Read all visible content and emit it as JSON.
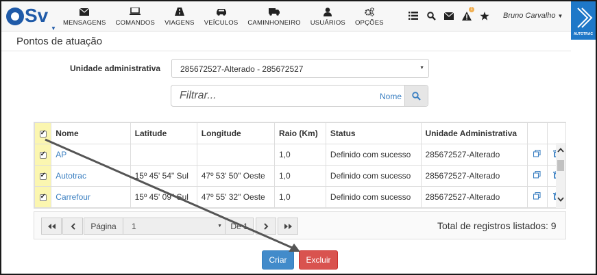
{
  "app": {
    "logo_text": "Sv"
  },
  "nav": {
    "items": [
      {
        "label": "MENSAGENS",
        "icon": "envelope-icon"
      },
      {
        "label": "COMANDOS",
        "icon": "laptop-icon"
      },
      {
        "label": "VIAGENS",
        "icon": "road-icon"
      },
      {
        "label": "VEÍCULOS",
        "icon": "car-icon"
      },
      {
        "label": "CAMINHONEIRO",
        "icon": "truck-icon"
      },
      {
        "label": "USUÁRIOS",
        "icon": "user-icon"
      },
      {
        "label": "OPÇÕES",
        "icon": "cogs-icon"
      }
    ],
    "tools": [
      "list-icon",
      "search-icon",
      "envelope-icon",
      "warning-icon",
      "star-icon"
    ],
    "warning_badge": "1",
    "user_name": "Bruno Carvalho",
    "brand_text": "AUTOTRAC"
  },
  "page": {
    "title": "Pontos de atuação"
  },
  "form": {
    "unidade_label": "Unidade administrativa",
    "unidade_value": "285672527-Alterado - 285672527",
    "filter_placeholder": "Filtrar...",
    "filter_field": "Nome"
  },
  "table": {
    "headers": [
      "Nome",
      "Latitude",
      "Longitude",
      "Raio (Km)",
      "Status",
      "Unidade Administrativa"
    ],
    "rows": [
      {
        "nome": "AP",
        "latitude": "",
        "longitude": "",
        "raio": "1,0",
        "status": "Definido com sucesso",
        "unidade": "285672527-Alterado"
      },
      {
        "nome": "Autotrac",
        "latitude": "15º 45' 54\" Sul",
        "longitude": "47º 53' 50\" Oeste",
        "raio": "1,0",
        "status": "Definido com sucesso",
        "unidade": "285672527-Alterado"
      },
      {
        "nome": "Carrefour",
        "latitude": "15º 45' 09\" Sul",
        "longitude": "47º 55' 32\" Oeste",
        "raio": "1,0",
        "status": "Definido com sucesso",
        "unidade": "285672527-Alterado"
      }
    ]
  },
  "pager": {
    "page_label": "Página",
    "page_value": "1",
    "of_label": "De 1",
    "total_text": "Total de registros listados: 9"
  },
  "actions": {
    "create": "Criar",
    "delete": "Excluir"
  },
  "colors": {
    "primary": "#428bca",
    "danger": "#d9534f",
    "selected_col": "#fbf6b0",
    "brand": "#1e78c8"
  }
}
